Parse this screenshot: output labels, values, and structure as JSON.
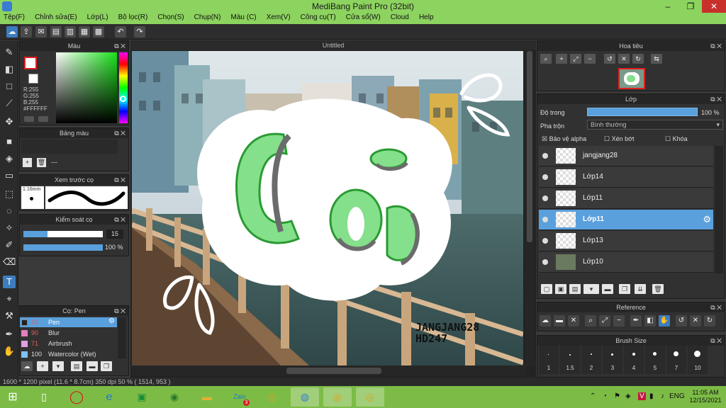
{
  "window": {
    "title": "MediBang Paint Pro (32bit)",
    "minimize": "–",
    "restore": "❐",
    "close": "✕"
  },
  "menu": [
    "Tệp(F)",
    "Chỉnh sửa(E)",
    "Lớp(L)",
    "Bộ lọc(R)",
    "Chọn(S)",
    "Chụp(N)",
    "Màu (C)",
    "Xem(V)",
    "Công cụ(T)",
    "Cửa sổ(W)",
    "Cloud",
    "Help"
  ],
  "document": {
    "tab": "Untitled"
  },
  "color_panel": {
    "title": "Màu",
    "rgb": [
      "R:255",
      "G:255",
      "B:255"
    ],
    "hex": "#FFFFFF",
    "primary": "#ffffff",
    "secondary": "#e02020"
  },
  "palette_panel": {
    "title": "Bảng màu",
    "dash": "---"
  },
  "brush_preview": {
    "title": "Xem trước cọ",
    "size": "1.16mm"
  },
  "brush_control": {
    "title": "Kiểm soát cọ",
    "size_value": "15",
    "opacity_value": "100 %"
  },
  "brush_panel": {
    "title": "Cọ: Pen",
    "items": [
      {
        "size": "15",
        "name": "Pen",
        "color": "#222222"
      },
      {
        "size": "90",
        "name": "Blur",
        "color": "#e080c0"
      },
      {
        "size": "71",
        "name": "Airbrush",
        "color": "#e0a0e0"
      },
      {
        "size": "100",
        "name": "Watercolor (Wet)",
        "color": "#80c0f0"
      }
    ]
  },
  "navigator": {
    "title": "Hoa tiêu"
  },
  "layer_panel": {
    "title": "Lớp",
    "opacity_label": "Độ trong",
    "opacity_value": "100 %",
    "blend_label": "Pha trộn",
    "blend_value": "Bình thường",
    "protect_alpha": "Bảo vệ alpha",
    "clip": "Xén bớt",
    "lock": "Khóa",
    "layers": [
      "jangjang28",
      "Lớp14",
      "Lớp11",
      "Lớp11",
      "Lớp13",
      "Lớp10"
    ],
    "selected_index": 3
  },
  "reference_panel": {
    "title": "Reference"
  },
  "brush_size_panel": {
    "title": "Brush Size",
    "sizes": [
      "1",
      "1.5",
      "2",
      "3",
      "4",
      "5",
      "7",
      "10"
    ]
  },
  "canvas": {
    "signature_line1": "JANGJANG28",
    "signature_line2": "HD247"
  },
  "status": {
    "text": "1600 * 1200 pixel (11.6 * 8.7cm) 350 dpi 50 % ( 1514, 953 )"
  },
  "taskbar": {
    "time": "11:05 AM",
    "date": "12/15/2021",
    "lang": "ENG",
    "zalo_badge": "3"
  }
}
